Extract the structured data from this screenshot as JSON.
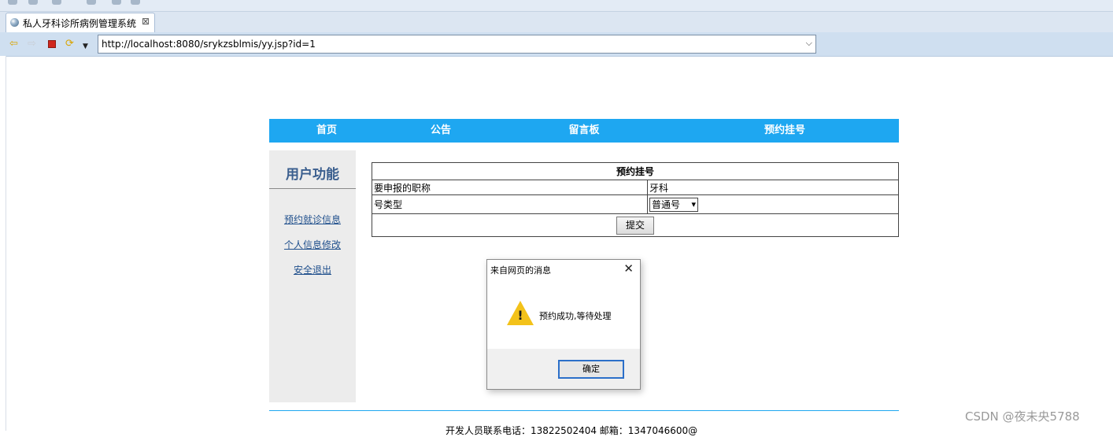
{
  "browser": {
    "tab_title": "私人牙科诊所病例管理系统",
    "tab_close": "⊠",
    "url": "http://localhost:8080/srykzsblmis/yy.jsp?id=1",
    "icons": {
      "back": "back-arrow-icon",
      "forward": "forward-arrow-icon",
      "stop": "stop-icon",
      "refresh": "refresh-icon",
      "url_dropdown": "chevron-down-icon"
    }
  },
  "nav": {
    "color": "#1ea7f1",
    "items": [
      {
        "label": "首页"
      },
      {
        "label": "公告"
      },
      {
        "label": "留言板"
      },
      {
        "label": "预约挂号"
      }
    ]
  },
  "sidebar": {
    "title": "用户功能",
    "links": [
      {
        "label": "预约就诊信息"
      },
      {
        "label": "个人信息修改"
      },
      {
        "label": "安全退出"
      }
    ]
  },
  "form": {
    "title": "预约挂号",
    "rows": [
      {
        "label": "要申报的职称",
        "value": "牙科"
      },
      {
        "label": "号类型",
        "selected": "普通号"
      }
    ],
    "submit_label": "提交"
  },
  "dialog": {
    "title": "来自网页的消息",
    "message": "预约成功,等待处理",
    "ok_label": "确定",
    "icon": "warning-icon"
  },
  "footer": {
    "text": "开发人员联系电话：13822502404 邮箱：1347046600@"
  },
  "watermark": "CSDN @夜未央5788"
}
